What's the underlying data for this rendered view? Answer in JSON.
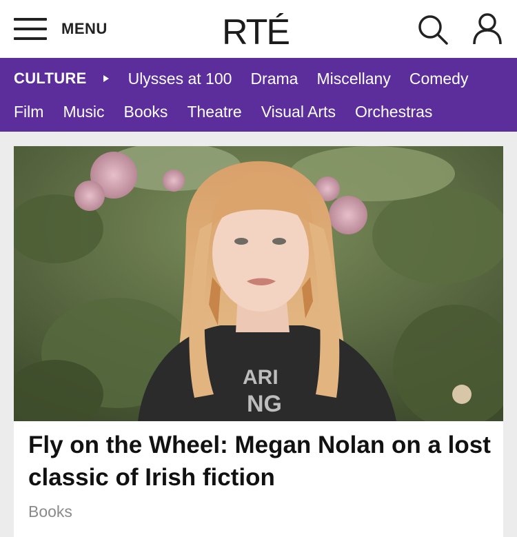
{
  "header": {
    "menu_label": "MENU",
    "logo_text": "RTÉ"
  },
  "subnav": {
    "section": "CULTURE",
    "row1": [
      "Ulysses at 100",
      "Drama",
      "Miscellany",
      "Comedy"
    ],
    "row2": [
      "Film",
      "Music",
      "Books",
      "Theatre",
      "Visual Arts",
      "Orchestras"
    ]
  },
  "article": {
    "headline": "Fly on the Wheel: Megan Nolan on a lost classic of Irish fiction",
    "category": "Books",
    "image_alt": "Portrait of a woman with long strawberry-blonde hair and a fringe sitting among rose bushes"
  },
  "colors": {
    "nav_purple": "#5b2e9c",
    "header_bg": "#ffffff",
    "page_bg": "#ececec"
  }
}
